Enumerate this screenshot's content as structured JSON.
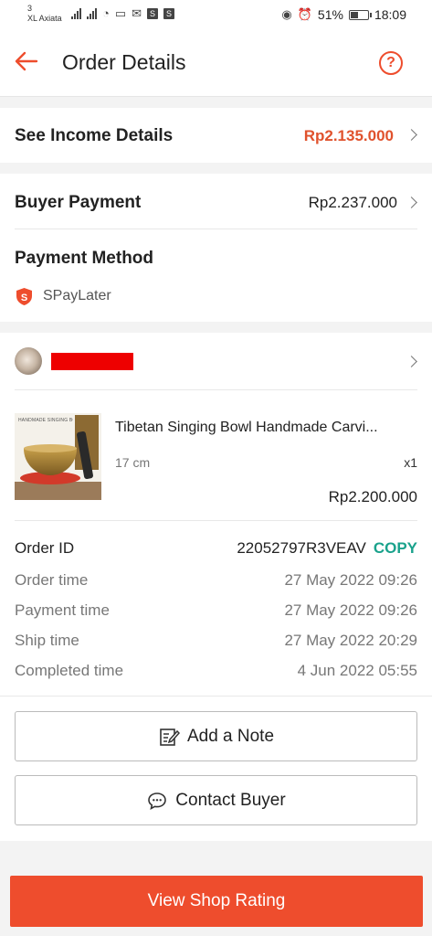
{
  "status_bar": {
    "carrier_line1": "3",
    "carrier_line2": "XL Axiata",
    "battery": "51%",
    "time": "18:09"
  },
  "header": {
    "title": "Order Details"
  },
  "income": {
    "label": "See Income Details",
    "amount": "Rp2.135.000"
  },
  "payment": {
    "buyer_payment_label": "Buyer Payment",
    "buyer_payment_amount": "Rp2.237.000",
    "method_label": "Payment Method",
    "method_value": "SPayLater"
  },
  "product": {
    "thumbnail_caption": "HANDMADE SINGING BOWL",
    "name": "Tibetan Singing Bowl Handmade Carvi...",
    "variant": "17 cm",
    "quantity": "x1",
    "price": "Rp2.200.000"
  },
  "order": {
    "id_label": "Order ID",
    "id_value": "22052797R3VEAV",
    "copy_label": "COPY",
    "rows": [
      {
        "label": "Order time",
        "value": "27 May 2022 09:26"
      },
      {
        "label": "Payment time",
        "value": "27 May 2022 09:26"
      },
      {
        "label": "Ship time",
        "value": "27 May 2022 20:29"
      },
      {
        "label": "Completed time",
        "value": "4 Jun 2022 05:55"
      }
    ]
  },
  "actions": {
    "add_note": "Add a Note",
    "contact_buyer": "Contact Buyer",
    "view_rating": "View Shop Rating"
  },
  "colors": {
    "accent": "#ee4d2d",
    "copy": "#1aa28c"
  }
}
